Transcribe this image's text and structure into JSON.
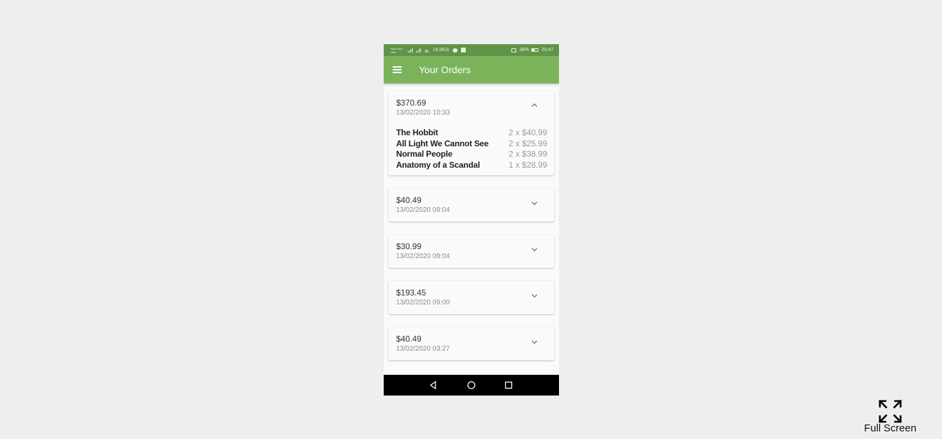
{
  "status_bar": {
    "carrier_line1": "Idea-Idea",
    "carrier_line2": "Idea",
    "network_speed": "18.6K/s",
    "battery": "38%",
    "time": "20:47"
  },
  "app_bar": {
    "title": "Your Orders",
    "menu_icon": "hamburger-menu-icon"
  },
  "orders": [
    {
      "total": "$370.69",
      "date": "13/02/2020 10:33",
      "expanded": true,
      "items": [
        {
          "name": "The Hobbit",
          "qty": "2 x $40.99"
        },
        {
          "name": "All Light We Cannot See",
          "qty": "2 x $25.99"
        },
        {
          "name": "Normal People",
          "qty": "2 x $38.99"
        },
        {
          "name": "Anatomy of a Scandal",
          "qty": "1 x $28.99"
        }
      ]
    },
    {
      "total": "$40.49",
      "date": "13/02/2020 09:04",
      "expanded": false
    },
    {
      "total": "$30.99",
      "date": "13/02/2020 09:04",
      "expanded": false
    },
    {
      "total": "$193.45",
      "date": "13/02/2020 09:00",
      "expanded": false
    },
    {
      "total": "$40.49",
      "date": "13/02/2020 03:27",
      "expanded": false
    }
  ],
  "nav_bar": {
    "buttons": [
      "back-icon",
      "home-icon",
      "recents-icon"
    ]
  },
  "fullscreen": {
    "label": "Full Screen",
    "icon": "expand-arrows-icon"
  },
  "colors": {
    "status_bar": "#5f9449",
    "app_bar": "#7bb35a",
    "background": "#eeeeee",
    "card": "#fafafa",
    "nav_bar": "#000000"
  }
}
